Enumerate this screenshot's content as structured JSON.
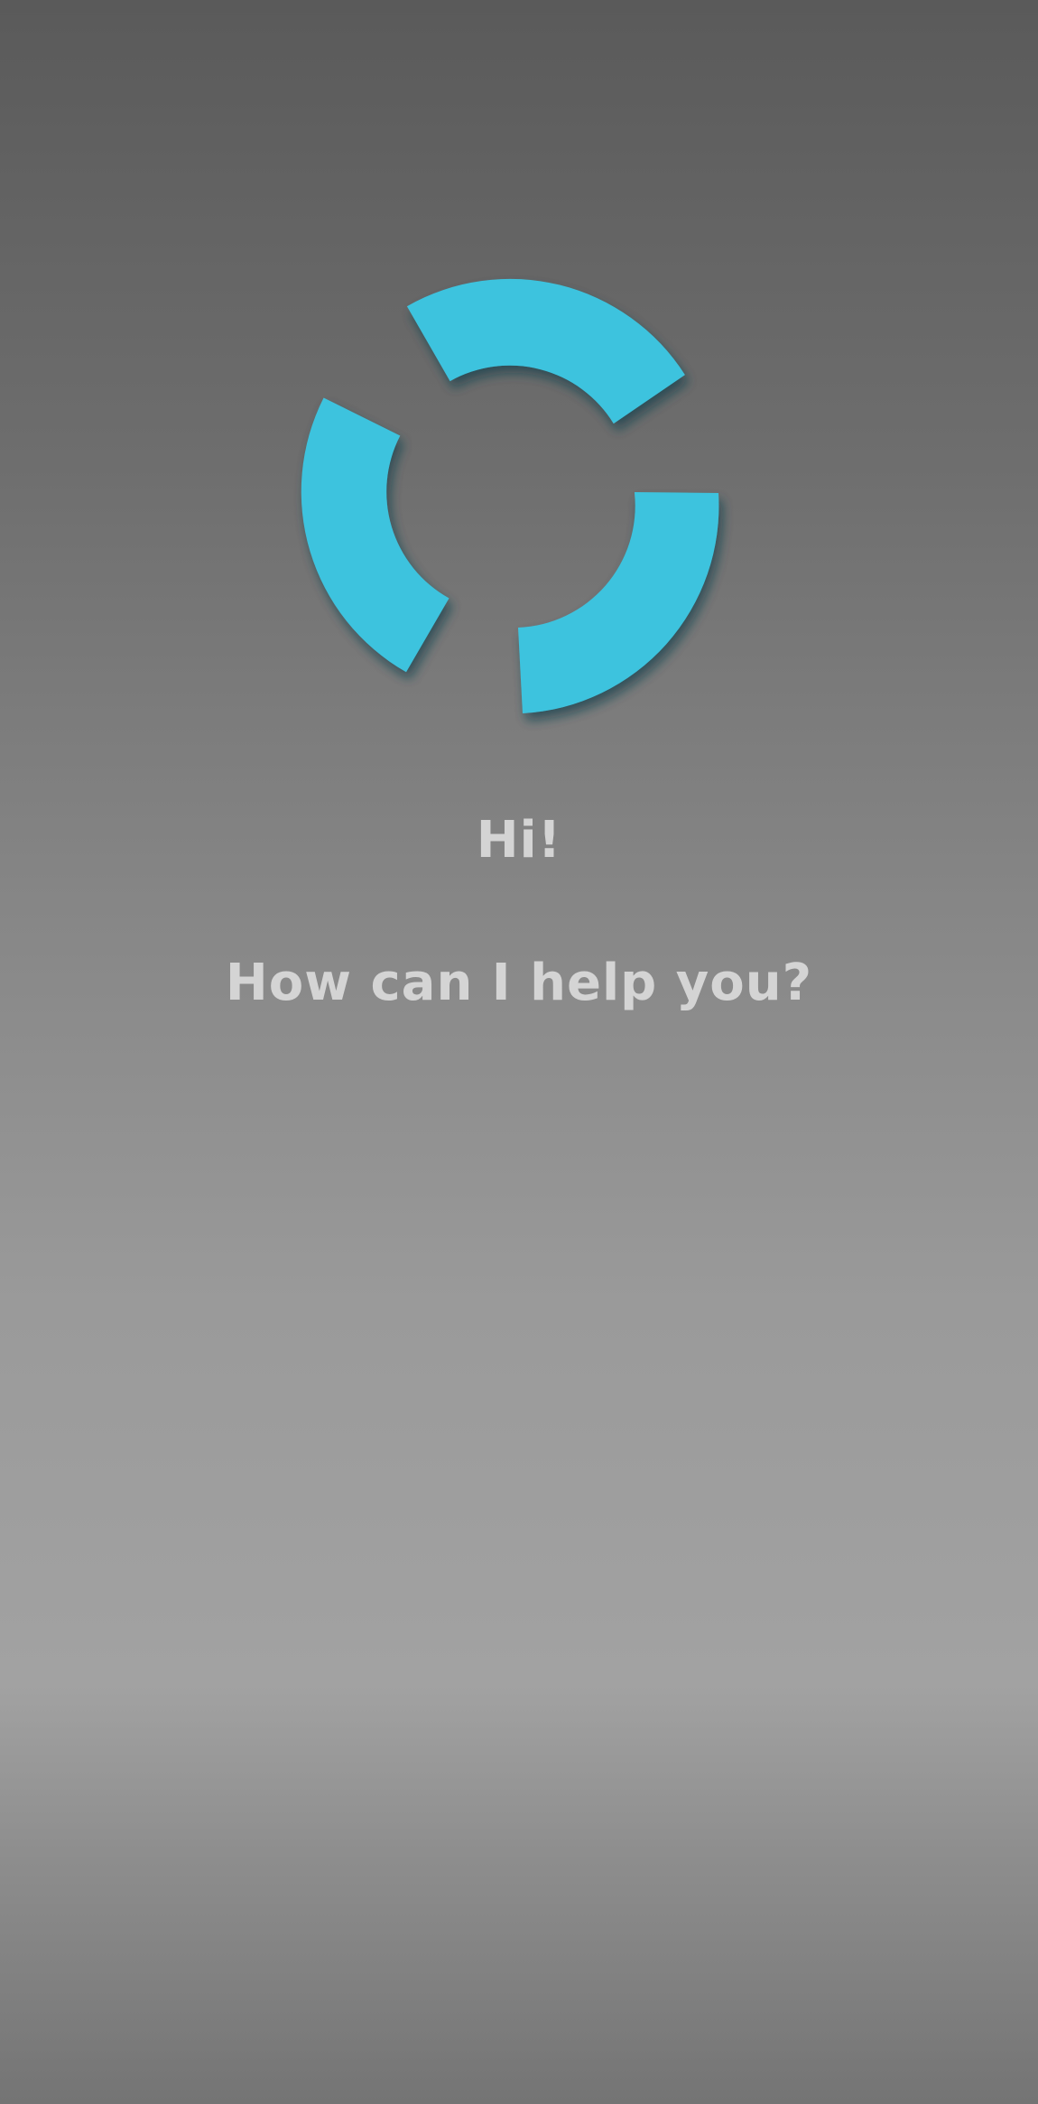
{
  "assistant": {
    "logo_icon": "segmented-ring-icon",
    "accent_color": "#3ec3de",
    "greeting": "Hi!",
    "prompt": "How can I help you?"
  },
  "colors": {
    "text": "#d4d4d4",
    "background_top": "#5a5a5a",
    "background_bottom": "#747474"
  }
}
